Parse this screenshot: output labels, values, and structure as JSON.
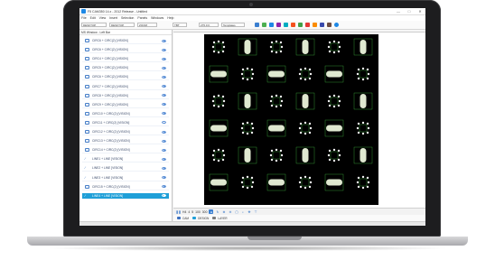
{
  "window": {
    "title": "F5 CAM350 14.x - 2012 Release - Untitled",
    "controls": [
      "—",
      "□",
      "✕"
    ]
  },
  "menu": [
    "File",
    "Edit",
    "View",
    "Insert",
    "Selection",
    "Panels",
    "Windows",
    "Help"
  ],
  "toolbar": {
    "layer_field": "DESKTOP",
    "layer_field_2": "DESKTOP",
    "zoom_field": "ZOOM",
    "net_field": "TBT",
    "size_field": "275.0 K",
    "mode_field": "Templates"
  },
  "panel": {
    "header": "MS Window - Left Bar",
    "rows": [
      {
        "label": "CIRC6 + CIRC(2) [VISION]",
        "icon": "circle-icon"
      },
      {
        "label": "CIRC6 + CIRC(2) [VISION]",
        "icon": "circle-icon"
      },
      {
        "label": "CIRC4 + CIRC(2) [VISION]",
        "icon": "circle-icon"
      },
      {
        "label": "CIRC5 + CIRC(2) [VISION]",
        "icon": "circle-icon"
      },
      {
        "label": "CIRC6 + CIRC(2) [VISION]",
        "icon": "circle-icon"
      },
      {
        "label": "CIRC7 + CIRC(2) [VISION]",
        "icon": "circle-icon"
      },
      {
        "label": "CIRC8 + CIRC(2) [VISION]",
        "icon": "circle-icon"
      },
      {
        "label": "CIRC9 + CIRC(2) [VISION]",
        "icon": "circle-icon"
      },
      {
        "label": "CIRC10 + CIRC(2) [VISION]",
        "icon": "circle-icon"
      },
      {
        "label": "CIRC11 + CIRC(2) [VISION]",
        "icon": "circle-icon"
      },
      {
        "label": "CIRC12 + CIRC(2) [VISION]",
        "icon": "circle-icon"
      },
      {
        "label": "CIRC13 + CIRC(2) [VISION]",
        "icon": "circle-icon"
      },
      {
        "label": "CIRC14 + CIRC(2) [VISION]",
        "icon": "circle-icon"
      },
      {
        "label": "LINE1 + LINE [VISION]",
        "icon": "line-icon"
      },
      {
        "label": "LINE2 + LINE [VISION]",
        "icon": "line-icon"
      },
      {
        "label": "LINE3 + LINE [VISION]",
        "icon": "line-icon"
      },
      {
        "label": "CIRC15 + CIRC(2) [VISION]",
        "icon": "circle-icon"
      },
      {
        "label": "LINE4 + LINE [VISION]",
        "icon": "line-icon",
        "selected": true
      }
    ]
  },
  "bottombar": {
    "labels": [
      "H4",
      "4",
      "5",
      "100",
      "300"
    ]
  },
  "tabs": [
    {
      "label": "CAM",
      "color": "#3b6fbf"
    },
    {
      "label": "DESIGN",
      "color": "#1f9fd8"
    },
    {
      "label": "LAYER",
      "color": "#7a7a7a"
    }
  ],
  "colors": {
    "accent": "#1f9fd8",
    "canvas_bg": "#000000",
    "pad_fill": "#dfe8d0",
    "outline": "#3fae3f"
  }
}
